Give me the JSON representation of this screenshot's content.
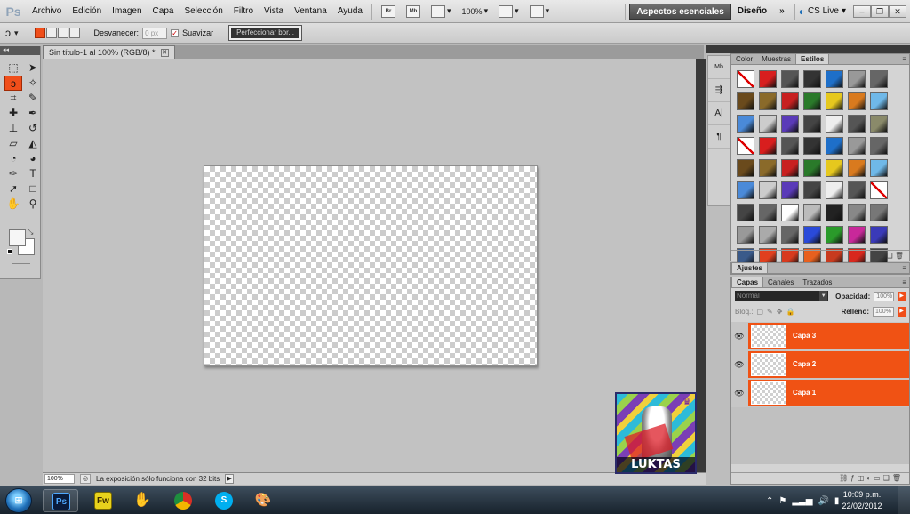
{
  "menubar": {
    "logo": "Ps",
    "items": [
      "Archivo",
      "Edición",
      "Imagen",
      "Capa",
      "Selección",
      "Filtro",
      "Vista",
      "Ventana",
      "Ayuda"
    ],
    "bridge_label": "Br",
    "minibridge_label": "Mb",
    "zoom": "100%",
    "workspace_active": "Aspectos esenciales",
    "workspace_other": "Diseño",
    "more": "»",
    "cslive": "CS Live"
  },
  "options": {
    "feather_label": "Desvanecer:",
    "feather_value": "0 px",
    "antialias_label": "Suavizar",
    "refine_label": "Perfeccionar bor..."
  },
  "document": {
    "tab_title": "Sin título-1 al 100% (RGB/8) *",
    "zoom": "100%",
    "status": "La exposición sólo funciona con 32 bits",
    "avatar_text": "LUKTAS"
  },
  "panels": {
    "styles_tabs": [
      "Color",
      "Muestras",
      "Estilos"
    ],
    "adjust_tab": "Ajustes",
    "layers_tabs": [
      "Capas",
      "Canales",
      "Trazados"
    ],
    "blend_mode": "Normal",
    "opacity_label": "Opacidad:",
    "opacity_value": "100%",
    "lock_label": "Bloq.:",
    "fill_label": "Relleno:",
    "fill_value": "100%",
    "layers": [
      {
        "name": "Capa 3"
      },
      {
        "name": "Capa 2"
      },
      {
        "name": "Capa 1"
      }
    ]
  },
  "taskbar": {
    "time": "10:09 p.m.",
    "date": "22/02/2012",
    "apps": [
      "Ps",
      "Fw"
    ]
  },
  "colors": {
    "accent": "#f04e1a",
    "layer_selected": "#f05214"
  }
}
